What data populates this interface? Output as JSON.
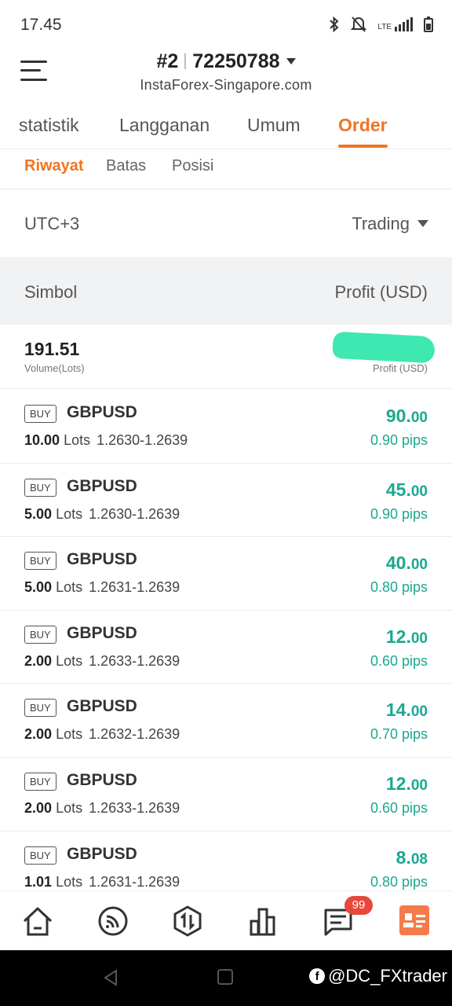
{
  "status_bar": {
    "time": "17.45",
    "icons": [
      "bluetooth-icon",
      "bell-off-icon",
      "lte-signal-icon",
      "battery-icon"
    ],
    "network_label": "LTE"
  },
  "header": {
    "account_prefix": "#2",
    "account_number": "72250788",
    "server": "InstaForex-Singapore.com"
  },
  "main_tabs": [
    "statistik",
    "Langganan",
    "Umum",
    "Order"
  ],
  "active_main_tab": "Order",
  "sub_tabs": [
    "Riwayat",
    "Batas",
    "Posisi"
  ],
  "active_sub_tab": "Riwayat",
  "filter": {
    "timezone": "UTC+3",
    "mode": "Trading"
  },
  "columns": {
    "left": "Simbol",
    "right": "Profit (USD)"
  },
  "summary": {
    "volume": "191.51",
    "volume_label": "Volume(Lots)",
    "profit_label": "Profit (USD)"
  },
  "orders": [
    {
      "side": "BUY",
      "symbol": "GBPUSD",
      "lots": "10.00",
      "lots_word": "Lots",
      "range": "1.2630-1.2639",
      "profit_int": "90.",
      "profit_dec": "00",
      "pips": "0.90 pips"
    },
    {
      "side": "BUY",
      "symbol": "GBPUSD",
      "lots": "5.00",
      "lots_word": "Lots",
      "range": "1.2630-1.2639",
      "profit_int": "45.",
      "profit_dec": "00",
      "pips": "0.90 pips"
    },
    {
      "side": "BUY",
      "symbol": "GBPUSD",
      "lots": "5.00",
      "lots_word": "Lots",
      "range": "1.2631-1.2639",
      "profit_int": "40.",
      "profit_dec": "00",
      "pips": "0.80 pips"
    },
    {
      "side": "BUY",
      "symbol": "GBPUSD",
      "lots": "2.00",
      "lots_word": "Lots",
      "range": "1.2633-1.2639",
      "profit_int": "12.",
      "profit_dec": "00",
      "pips": "0.60 pips"
    },
    {
      "side": "BUY",
      "symbol": "GBPUSD",
      "lots": "2.00",
      "lots_word": "Lots",
      "range": "1.2632-1.2639",
      "profit_int": "14.",
      "profit_dec": "00",
      "pips": "0.70 pips"
    },
    {
      "side": "BUY",
      "symbol": "GBPUSD",
      "lots": "2.00",
      "lots_word": "Lots",
      "range": "1.2633-1.2639",
      "profit_int": "12.",
      "profit_dec": "00",
      "pips": "0.60 pips"
    },
    {
      "side": "BUY",
      "symbol": "GBPUSD",
      "lots": "1.01",
      "lots_word": "Lots",
      "range": "1.2631-1.2639",
      "profit_int": "8.",
      "profit_dec": "08",
      "pips": "0.80 pips"
    }
  ],
  "bottom_nav": {
    "items": [
      "home-icon",
      "market-feed-icon",
      "trade-icon",
      "chart-icon",
      "chat-icon",
      "profile-icon"
    ],
    "chat_badge": "99"
  },
  "watermark": "@DC_FXtrader",
  "colors": {
    "accent": "#f07422",
    "profit": "#1aa890",
    "badge": "#e8483c",
    "profile": "#f37c4a"
  }
}
